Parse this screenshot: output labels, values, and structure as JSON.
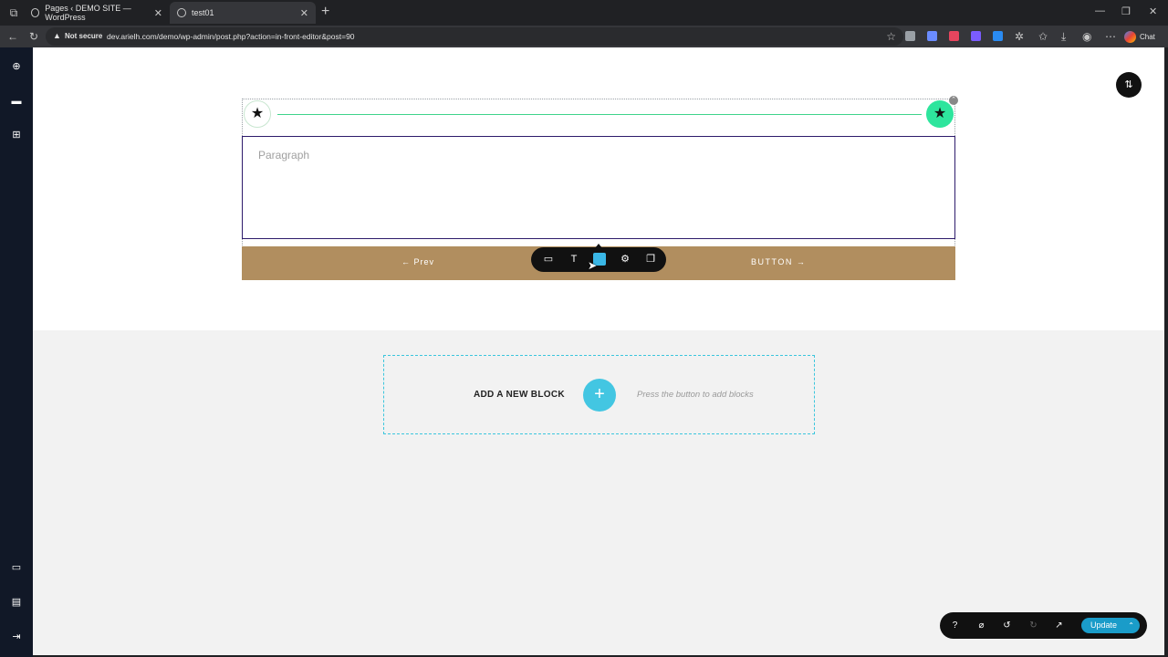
{
  "browser": {
    "tabs": [
      {
        "title": "Pages ‹ DEMO SITE — WordPress",
        "active": false
      },
      {
        "title": "test01",
        "active": true
      }
    ],
    "security_label": "Not secure",
    "url": "dev.arielh.com/demo/wp-admin/post.php?action=in-front-editor&post=90",
    "chat_label": "Chat"
  },
  "editor": {
    "paragraph_placeholder": "Paragraph",
    "prev_label": "← Prev",
    "button_label": "BUTTON →",
    "add_block_label": "ADD A NEW BLOCK",
    "add_block_plus": "+",
    "add_block_hint": "Press the button to add blocks",
    "update_label": "Update"
  },
  "colors": {
    "accent": "#43c6e2",
    "button_bar": "#b18e5f",
    "star_active": "#2ee59d",
    "update": "#1a9cc9",
    "sidebar": "#111827"
  },
  "icons": {
    "toolbar": [
      "block-settings-icon",
      "text-icon",
      "background-icon",
      "gear-icon",
      "copy-icon"
    ],
    "bottom_bar": [
      "help-icon",
      "hide-icon",
      "undo-icon",
      "redo-icon",
      "external-link-icon"
    ],
    "sidebar": [
      "add-icon",
      "layers-icon",
      "templates-icon",
      "desktop-icon",
      "page-icon",
      "exit-icon"
    ]
  }
}
